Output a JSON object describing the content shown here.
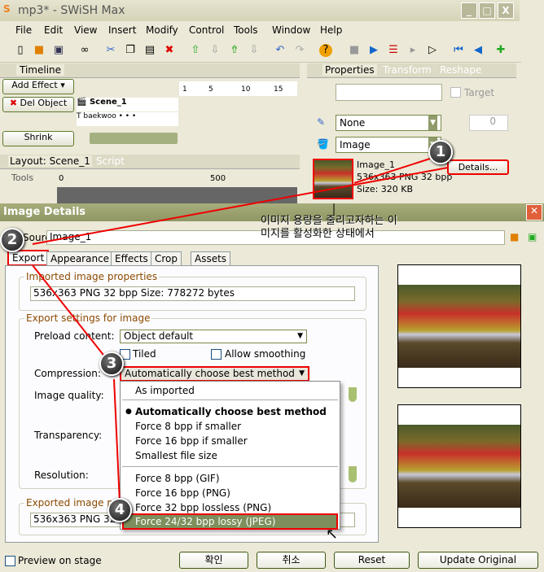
{
  "window": {
    "title": "mp3* - SWiSH Max",
    "minimize": "_",
    "maximize": "□",
    "close": "X"
  },
  "menu": [
    "File",
    "Edit",
    "View",
    "Insert",
    "Modify",
    "Control",
    "Tools",
    "Window",
    "Help"
  ],
  "toolbar_icons": [
    "new-icon",
    "open-icon",
    "save-icon",
    "preview-icon",
    "cut-icon",
    "copy-icon",
    "paste-icon",
    "delete-icon",
    "move-up-icon",
    "move-down-icon",
    "bring-front-icon",
    "send-back-icon",
    "undo-icon",
    "redo-icon",
    "help-icon",
    "stop-icon",
    "play-icon",
    "play-timeline-icon",
    "play-effect-icon",
    "play-scene-icon",
    "rewind-icon",
    "step-back-icon",
    "add-scene-icon"
  ],
  "timeline": {
    "tab": "Timeline",
    "add_effect": "Add Effect",
    "del_object": "Del Object",
    "shrink": "Shrink",
    "rows": [
      "Scene_1",
      "baekwoo"
    ],
    "ruler": [
      "1",
      "5",
      "10",
      "15"
    ]
  },
  "layout": {
    "tab": "Layout: Scene_1",
    "script_tab": "Script",
    "tools": "Tools",
    "ruler": [
      "0",
      "500"
    ]
  },
  "properties": {
    "tabs": [
      "Properties",
      "Transform",
      "Reshape"
    ],
    "target": "Target",
    "line": "None",
    "line_width": "0",
    "fill": "Image",
    "image_name": "Image_1",
    "image_info": "536x363 PNG 32 bpp",
    "image_size": "Size: 320 KB",
    "details": "Details..."
  },
  "annotation": {
    "text_line1": "이미지 용량을 줄리고자하는 이",
    "text_line2": "미지를 활성화한 상태에서",
    "steps": [
      "1",
      "2",
      "3",
      "4"
    ]
  },
  "dialog": {
    "title": "Image Details",
    "name_label": "Source",
    "name_value": "Image_1",
    "tabs": [
      "Export",
      "Appearance",
      "Effects",
      "Crop",
      "Assets"
    ],
    "imported_group": "Imported image properties",
    "imported_value": "536x363 PNG 32 bpp Size: 778272 bytes",
    "export_group": "Export settings for image",
    "preload_label": "Preload content:",
    "preload_value": "Object default",
    "tiled": "Tiled",
    "allow_smoothing": "Allow smoothing",
    "compression_label": "Compression:",
    "compression_value": "Automatically choose best method",
    "quality_label": "Image quality:",
    "transparency_label": "Transparency:",
    "resolution_label": "Resolution:",
    "exported_group": "Exported image properties",
    "exported_value": "536x363 PNG 32 bpp",
    "options": [
      "As imported",
      "Automatically choose best method",
      "Force 8 bpp if smaller",
      "Force 16 bpp if smaller",
      "Smallest file size",
      "Force 8 bpp (GIF)",
      "Force 16 bpp (PNG)",
      "Force 32 bpp lossless (PNG)",
      "Force 24/32 bpp lossy (JPEG)"
    ],
    "selected_option": "Automatically choose best method",
    "highlighted_option": "Force 24/32 bpp lossy (JPEG)",
    "preview_on_stage": "Preview on stage",
    "ok": "확인",
    "cancel": "취소",
    "reset": "Reset",
    "update": "Update Original"
  },
  "colors": {
    "highlight": "#7d8f5c",
    "annotation_red": "#e00000",
    "dialog_title": "#8f9763"
  }
}
